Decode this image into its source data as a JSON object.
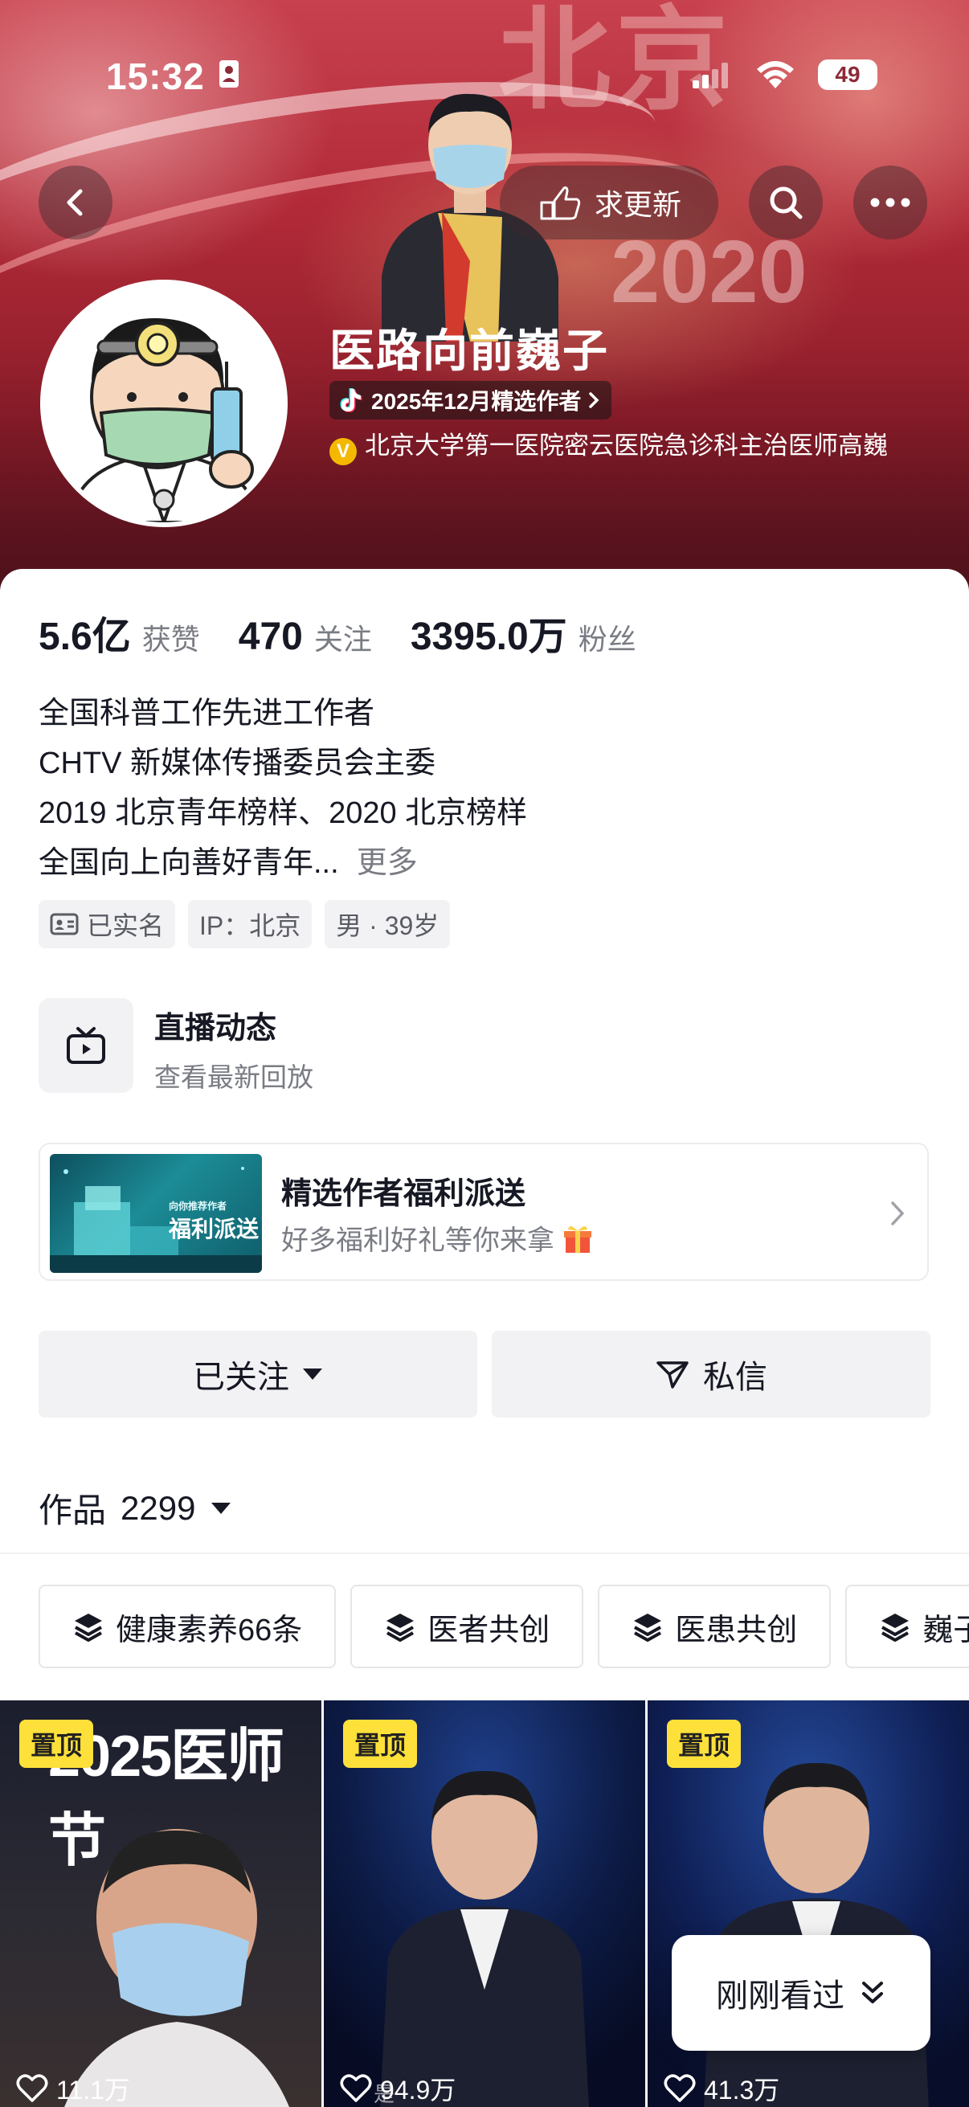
{
  "status_bar": {
    "time": "15:32",
    "battery": "49"
  },
  "header": {
    "refresh_label": "求更新",
    "nickname": "医路向前巍子",
    "badge_label": "2025年12月精选作者",
    "verify_text": "北京大学第一医院密云医院急诊科主治医师高巍"
  },
  "stats": [
    {
      "value": "5.6亿",
      "label": "获赞"
    },
    {
      "value": "470",
      "label": "关注"
    },
    {
      "value": "3395.0万",
      "label": "粉丝"
    }
  ],
  "bio": {
    "lines": [
      "全国科普工作先进工作者",
      "CHTV 新媒体传播委员会主委",
      "2019 北京青年榜样、2020 北京榜样",
      "全国向上向善好青年..."
    ],
    "more": "更多"
  },
  "tags": [
    "已实名",
    "IP：北京",
    "男 · 39岁"
  ],
  "live": {
    "title": "直播动态",
    "subtitle": "查看最新回放"
  },
  "promo": {
    "title": "精选作者福利派送",
    "subtitle": "好多福利好礼等你来拿",
    "image_text_small": "向你推荐作者",
    "image_text": "福利派送"
  },
  "actions": {
    "follow": "已关注",
    "message": "私信"
  },
  "works": {
    "label": "作品",
    "count": "2299"
  },
  "chips": [
    "健康素养66条",
    "医者共创",
    "医患共创",
    "巍子"
  ],
  "thumbnails": [
    {
      "pin": "置顶",
      "likes": "11.1万",
      "overlay": "2025医师节"
    },
    {
      "pin": "置顶",
      "likes": "94.9万",
      "overlay": "是"
    },
    {
      "pin": "置顶",
      "likes": "41.3万"
    }
  ],
  "recent_label": "刚刚看过",
  "banner_texts": {
    "bg_top": "北京",
    "bg_year": "2020"
  },
  "colors": {
    "accent_yellow": "#fde03a",
    "verify": "#f5b800",
    "banner": "#b22a38"
  }
}
